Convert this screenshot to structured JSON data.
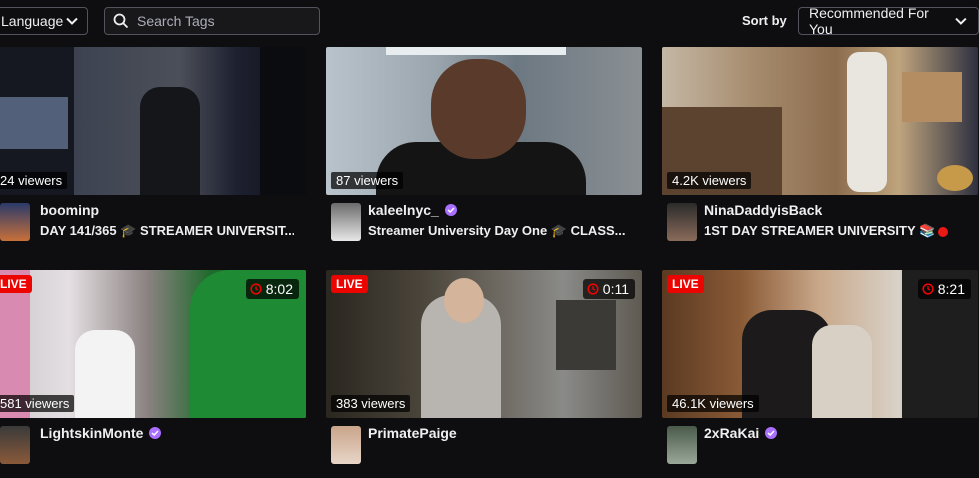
{
  "filters": {
    "language_label": "Language",
    "search_placeholder": "Search Tags",
    "sort_label": "Sort by",
    "sort_value": "Recommended For You"
  },
  "streams": [
    {
      "viewers": "24 viewers",
      "channel": "boominp",
      "title": "DAY 141/365 🎓 STREAMER UNIVERSIT...",
      "live": "",
      "uptime": "",
      "verified": false
    },
    {
      "viewers": "87 viewers",
      "channel": "kaleelnyc_",
      "title": "Streamer University Day One 🎓 CLASS...",
      "live": "",
      "uptime": "",
      "verified": true
    },
    {
      "viewers": "4.2K viewers",
      "channel": "NinaDaddyisBack",
      "title": "1ST DAY STREAMER UNIVERSITY 📚",
      "live": "",
      "uptime": "",
      "verified": false
    },
    {
      "viewers": "581 viewers",
      "channel": "LightskinMonte",
      "title": "",
      "live": "LIVE",
      "uptime": "8:02",
      "verified": true
    },
    {
      "viewers": "383 viewers",
      "channel": "PrimatePaige",
      "title": "",
      "live": "LIVE",
      "uptime": "0:11",
      "verified": false
    },
    {
      "viewers": "46.1K viewers",
      "channel": "2xRaKai",
      "title": "",
      "live": "LIVE",
      "uptime": "8:21",
      "verified": true
    }
  ],
  "colors": {
    "background": "#0e0e10",
    "live_red": "#eb0400",
    "verified_purple": "#a970ff"
  }
}
